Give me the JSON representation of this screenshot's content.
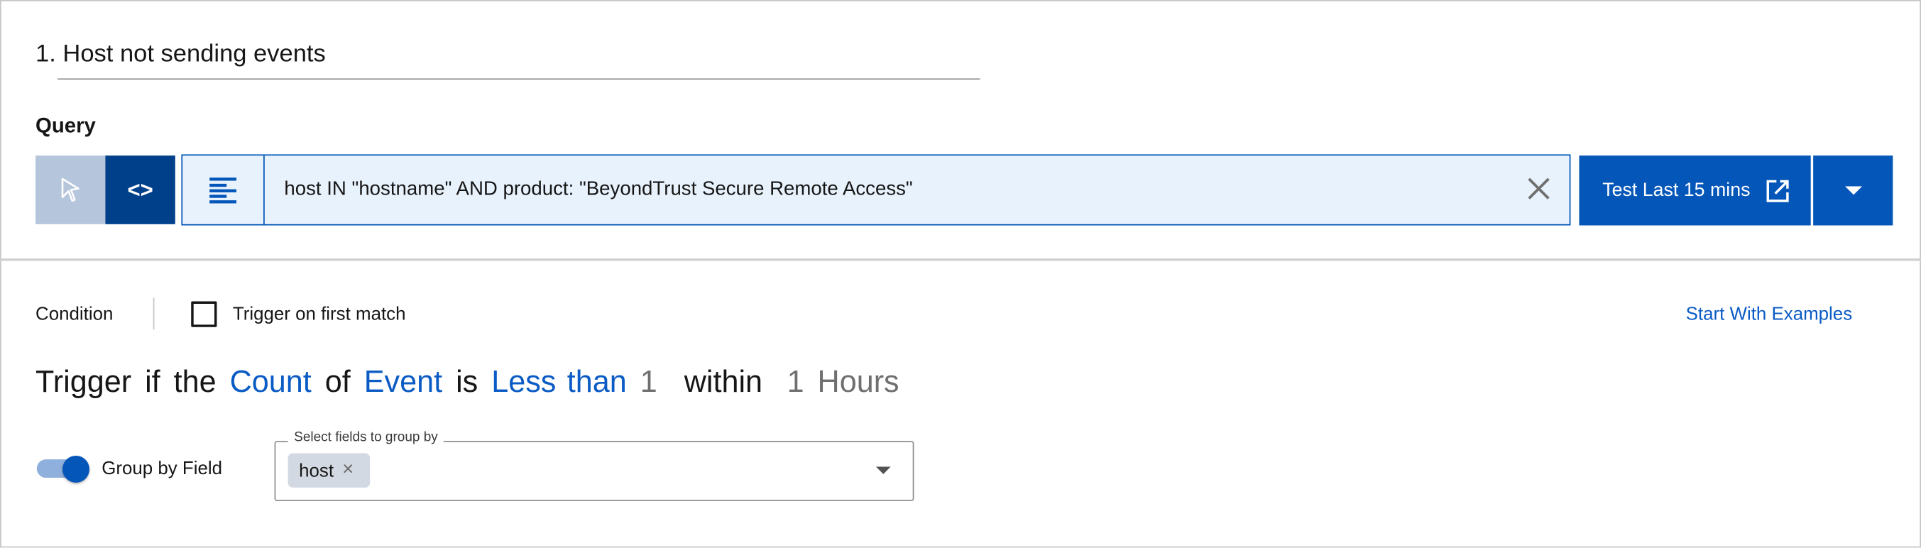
{
  "rule": {
    "title": "1. Host not sending events"
  },
  "query": {
    "label": "Query",
    "text": "host IN \"hostname\" AND product: \"BeyondTrust Secure Remote Access\"",
    "mode_buttons": [
      {
        "icon": "cursor-icon",
        "active": false
      },
      {
        "icon": "code-icon",
        "active": true,
        "glyph": "<>"
      }
    ],
    "test_button": "Test Last 15 mins",
    "accent": "#0456b9"
  },
  "condition": {
    "label": "Condition",
    "trigger_first_match": {
      "label": "Trigger on first match",
      "checked": false
    },
    "examples_link": "Start With Examples",
    "sentence": {
      "w1": "Trigger",
      "w2": "if",
      "w3": "the",
      "aggregate": "Count",
      "w4": "of",
      "target": "Event",
      "w5": "is",
      "operator": "Less than",
      "threshold": "1",
      "w6": "within",
      "window_value": "1",
      "window_unit": "Hours"
    }
  },
  "group_by": {
    "toggle_label": "Group by Field",
    "enabled": true,
    "select_legend": "Select fields to group by",
    "chips": [
      "host"
    ],
    "chip_remove": "×"
  }
}
